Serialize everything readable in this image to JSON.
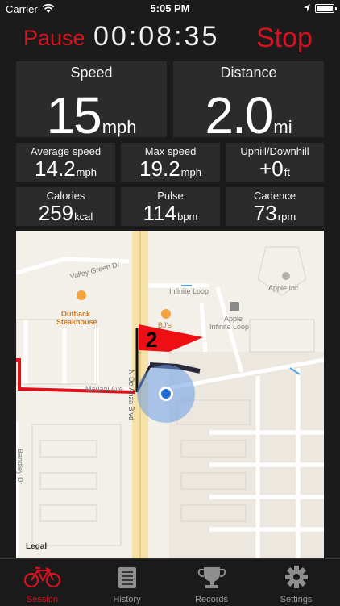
{
  "status_bar": {
    "carrier": "Carrier",
    "time": "5:05 PM"
  },
  "header": {
    "pause_label": "Pause",
    "timer": "00:08:35",
    "stop_label": "Stop"
  },
  "stats": {
    "speed": {
      "title": "Speed",
      "value": "15",
      "unit": "mph"
    },
    "distance": {
      "title": "Distance",
      "value": "2.0",
      "unit": "mi"
    },
    "average_speed": {
      "title": "Average speed",
      "value": "14.2",
      "unit": "mph"
    },
    "max_speed": {
      "title": "Max speed",
      "value": "19.2",
      "unit": "mph"
    },
    "uphill_downhill": {
      "title": "Uphill/Downhill",
      "value": "+0",
      "unit": "ft"
    },
    "calories": {
      "title": "Calories",
      "value": "259",
      "unit": "kcal"
    },
    "pulse": {
      "title": "Pulse",
      "value": "114",
      "unit": "bpm"
    },
    "cadence": {
      "title": "Cadence",
      "value": "73",
      "unit": "rpm"
    }
  },
  "map": {
    "labels": {
      "valley_green": "Valley Green Dr",
      "outback_line1": "Outback",
      "outback_line2": "Steakhouse",
      "bjs": "BJ's",
      "infinite_loop": "Infinite Loop",
      "apple_inc": "Apple Inc",
      "apple_il_line1": "Apple",
      "apple_il_line2": "Infinite Loop",
      "mariani": "Mariani Ave",
      "de_anza": "N De Anza Blvd",
      "bandley": "Bandley Dr"
    },
    "flag_number": "2",
    "legal": "Legal"
  },
  "tabs": [
    {
      "label": "Session",
      "icon": "bicycle-icon",
      "active": true
    },
    {
      "label": "History",
      "icon": "notebook-icon",
      "active": false
    },
    {
      "label": "Records",
      "icon": "trophy-icon",
      "active": false
    },
    {
      "label": "Settings",
      "icon": "gear-icon",
      "active": false
    }
  ],
  "colors": {
    "accent": "#d8111f",
    "route": "#e0101a",
    "location": "#1f6fd6"
  }
}
